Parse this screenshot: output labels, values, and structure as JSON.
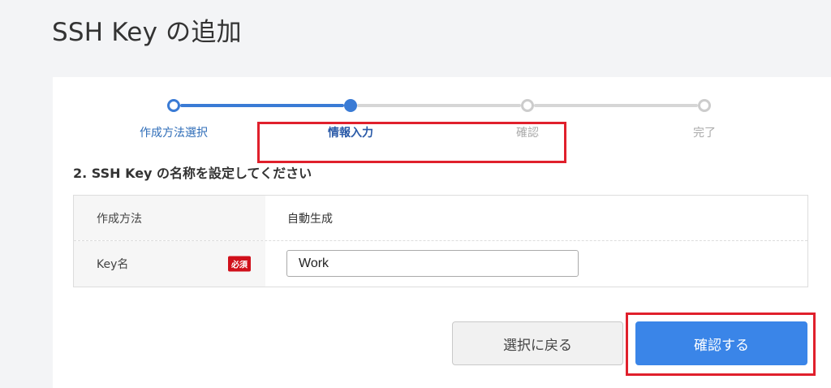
{
  "header": {
    "title": "SSH Key の追加"
  },
  "stepper": {
    "steps": [
      {
        "label": "作成方法選択",
        "state": "done"
      },
      {
        "label": "情報入力",
        "state": "current"
      },
      {
        "label": "確認",
        "state": "pending"
      },
      {
        "label": "完了",
        "state": "pending"
      }
    ]
  },
  "section": {
    "title": "2. SSH Key の名称を設定してください"
  },
  "form": {
    "rows": [
      {
        "label": "作成方法",
        "value": "自動生成"
      },
      {
        "label": "Key名",
        "required_badge": "必須",
        "input_value": "Work"
      }
    ]
  },
  "buttons": {
    "back_label": "選択に戻る",
    "confirm_label": "確認する"
  },
  "colors": {
    "accent": "#3a85e8",
    "step_active": "#3a7bd5",
    "required_badge": "#d0101b",
    "highlight": "#e0202c"
  }
}
